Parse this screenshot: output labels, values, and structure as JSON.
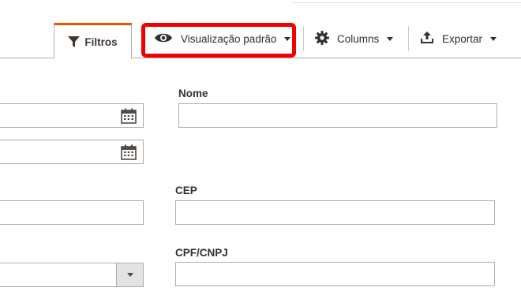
{
  "toolbar": {
    "filters_label": "Filtros",
    "view_label": "Visualização padrão",
    "columns_label": "Columns",
    "export_label": "Exportar"
  },
  "filters": {
    "name_label": "Nome",
    "cep_label": "CEP",
    "cpf_label": "CPF/CNPJ"
  },
  "colors": {
    "accent_tab": "#eb5202",
    "highlight": "#f00000"
  },
  "icons": [
    "filter-icon",
    "eye-icon",
    "gear-icon",
    "upload-icon",
    "calendar-icon",
    "chevron-down-icon"
  ]
}
